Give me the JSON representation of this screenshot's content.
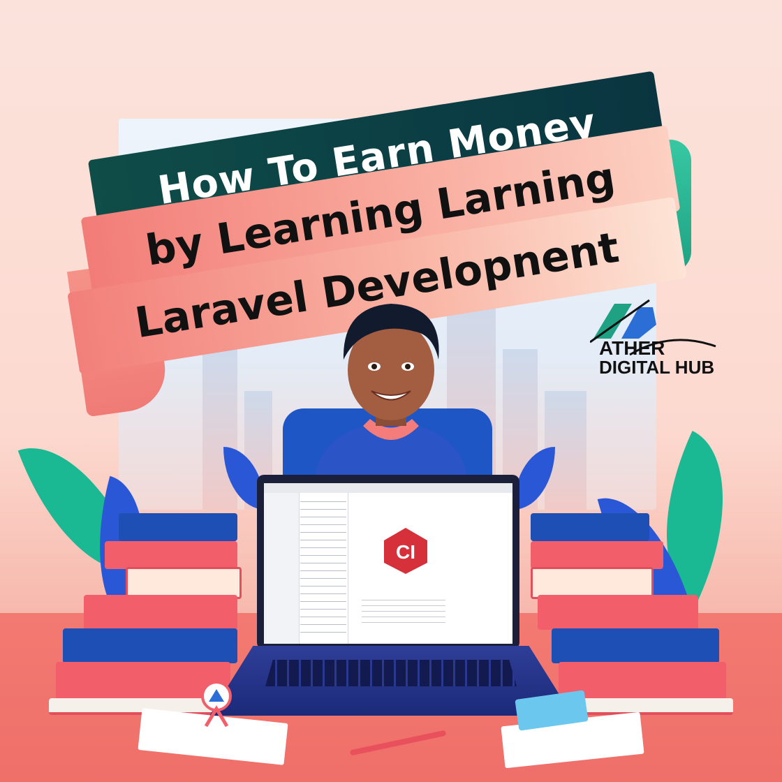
{
  "banner": {
    "line1": "How To Earn Money",
    "line2": "by Learning Larning",
    "line3": "Laravel Developnent"
  },
  "logo": {
    "line1": "ATHER",
    "line2": "DIGITAL HUB",
    "icon": "ather-logo-mark"
  },
  "screen": {
    "logo_text": "CI"
  },
  "colors": {
    "ribbon_dark": "#0b3e44",
    "ribbon_pink": "#f27c78",
    "accent_teal": "#1ea283",
    "laptop_blue": "#1f3a9c"
  }
}
